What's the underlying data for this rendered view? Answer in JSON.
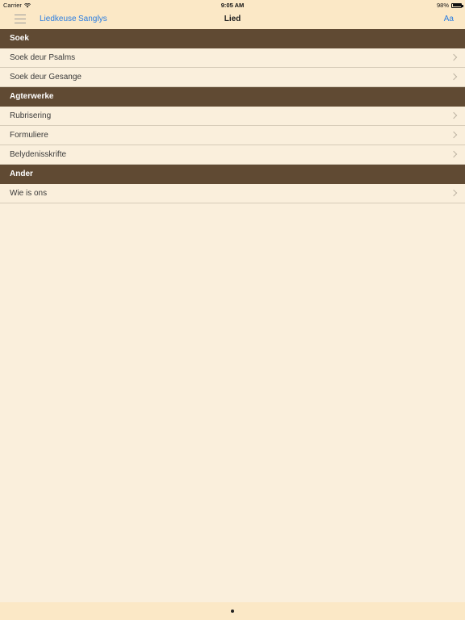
{
  "status_bar": {
    "carrier": "Carrier",
    "time": "9:05 AM",
    "battery": "98%",
    "battery_level": 0.98
  },
  "nav": {
    "links": [
      "Liedkeuse",
      "Sanglys"
    ],
    "title": "Lied",
    "right": "Aa"
  },
  "sections": [
    {
      "header": "Soek",
      "items": [
        "Soek deur Psalms",
        "Soek deur Gesange"
      ]
    },
    {
      "header": "Agterwerke",
      "items": [
        "Rubrisering",
        "Formuliere",
        "Belydenisskrifte"
      ]
    },
    {
      "header": "Ander",
      "items": [
        "Wie is ons"
      ]
    }
  ]
}
